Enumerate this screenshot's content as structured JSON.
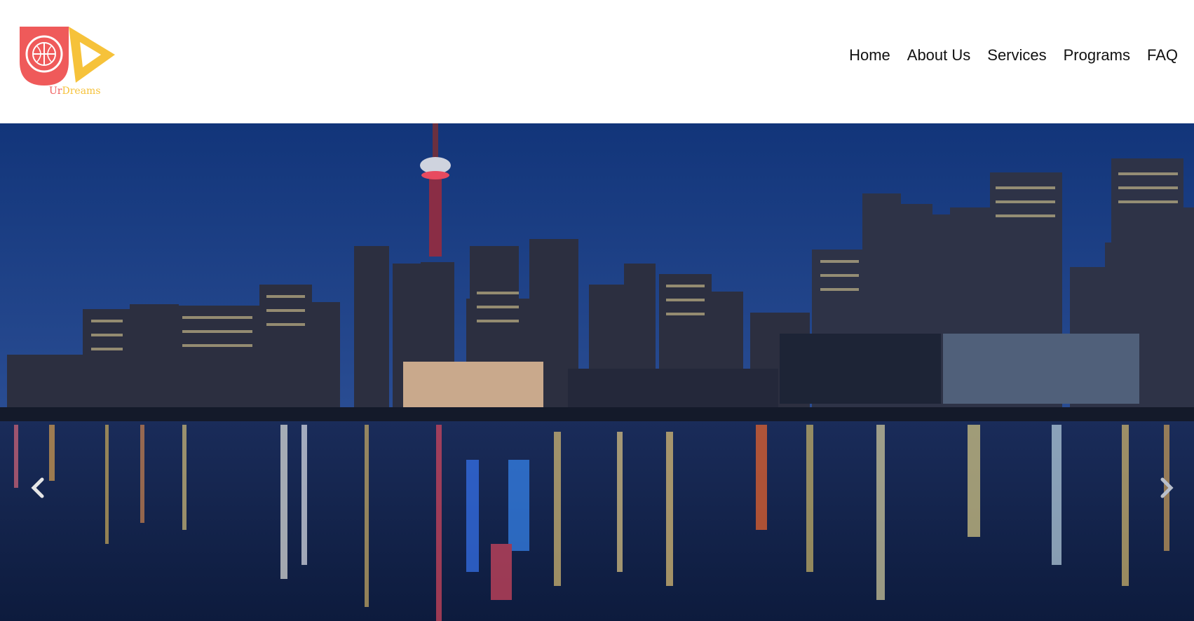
{
  "brand": {
    "name": "UrDreams",
    "name_parts": [
      "Ur",
      "Dreams"
    ],
    "primary_color": "#ef5a5a",
    "accent_color": "#f6c23a"
  },
  "nav": {
    "items": [
      {
        "label": "Home"
      },
      {
        "label": "About Us"
      },
      {
        "label": "Services"
      },
      {
        "label": "Programs"
      },
      {
        "label": "FAQ"
      }
    ]
  },
  "hero": {
    "image": "city-skyline-night-reflection",
    "controls": {
      "prev_icon": "chevron-left-icon",
      "next_icon": "chevron-right-icon"
    }
  }
}
